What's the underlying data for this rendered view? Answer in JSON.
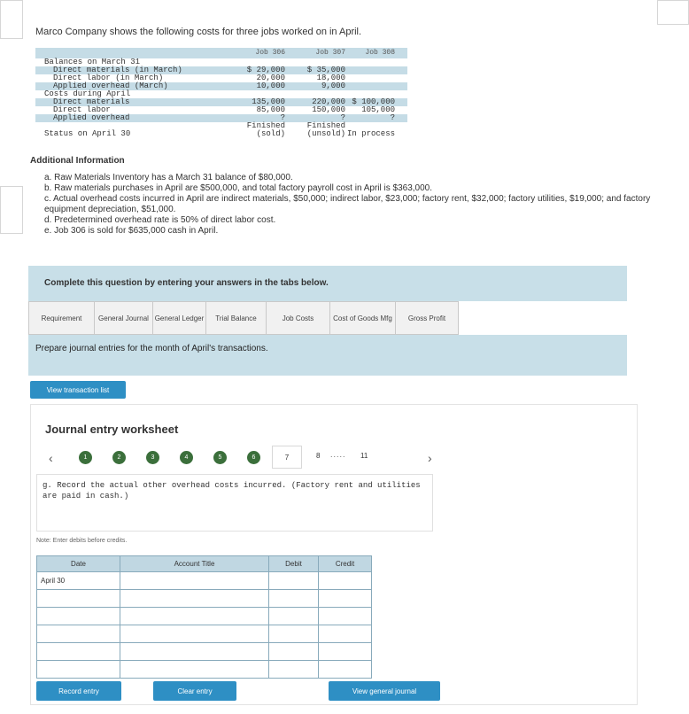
{
  "intro": "Marco Company shows the following costs for three jobs worked on in April.",
  "cost_table": {
    "jobs": [
      "Job 306",
      "Job 307",
      "Job 308"
    ],
    "rows": [
      {
        "label": "Balances on March 31",
        "indent": 0,
        "c1": "",
        "c2": "",
        "c3": "",
        "shade": false
      },
      {
        "label": "Direct materials (in March)",
        "indent": 1,
        "c1": "$ 29,000",
        "c2": "$ 35,000",
        "c3": "",
        "shade": true
      },
      {
        "label": "Direct labor (in March)",
        "indent": 1,
        "c1": "20,000",
        "c2": "18,000",
        "c3": "",
        "shade": false
      },
      {
        "label": "Applied overhead (March)",
        "indent": 1,
        "c1": "10,000",
        "c2": "9,000",
        "c3": "",
        "shade": true
      },
      {
        "label": "Costs during April",
        "indent": 0,
        "c1": "",
        "c2": "",
        "c3": "",
        "shade": false
      },
      {
        "label": "Direct materials",
        "indent": 1,
        "c1": "135,000",
        "c2": "220,000",
        "c3": "$ 100,000",
        "shade": true
      },
      {
        "label": "Direct labor",
        "indent": 1,
        "c1": "85,000",
        "c2": "150,000",
        "c3": "105,000",
        "shade": false
      },
      {
        "label": "Applied overhead",
        "indent": 1,
        "c1": "?",
        "c2": "?",
        "c3": "?",
        "shade": true
      },
      {
        "label": "",
        "indent": 0,
        "c1": "Finished",
        "c2": "Finished",
        "c3": "",
        "shade": false
      },
      {
        "label": "Status on April 30",
        "indent": 0,
        "c1": "(sold)",
        "c2": "(unsold)",
        "c3": "In process",
        "shade": false
      }
    ]
  },
  "additional": {
    "title": "Additional Information",
    "items": [
      "a. Raw Materials Inventory has a March 31 balance of $80,000.",
      "b. Raw materials purchases in April are $500,000, and total factory payroll cost in April is $363,000.",
      "c. Actual overhead costs incurred in April are indirect materials, $50,000; indirect labor, $23,000; factory rent, $32,000; factory utilities, $19,000; and factory equipment depreciation, $51,000.",
      "d. Predetermined overhead rate is 50% of direct labor cost.",
      "e. Job 306 is sold for $635,000 cash in April."
    ]
  },
  "instructions": "Complete this question by entering your answers in the tabs below.",
  "tabs": [
    {
      "label": "Requirement",
      "width": 74
    },
    {
      "label": "General Journal",
      "width": 66
    },
    {
      "label": "General Ledger",
      "width": 60
    },
    {
      "label": "Trial Balance",
      "width": 68
    },
    {
      "label": "Job Costs",
      "width": 72
    },
    {
      "label": "Cost of Goods Mfg",
      "width": 74
    },
    {
      "label": "Gross Profit",
      "width": 72
    }
  ],
  "prepare_text": "Prepare journal entries for the month of April's transactions.",
  "view_transaction_list": "View transaction list",
  "worksheet": {
    "title": "Journal entry worksheet",
    "pages": [
      "1",
      "2",
      "3",
      "4",
      "5",
      "6"
    ],
    "current_page": "7",
    "next_page": "8",
    "dots": ".....",
    "last_page": "11",
    "question": "g. Record the actual other overhead costs incurred. (Factory rent and utilities are paid in cash.)",
    "note": "Note: Enter debits before credits.",
    "columns": [
      "Date",
      "Account Title",
      "Debit",
      "Credit"
    ],
    "date_value": "April 30"
  },
  "buttons": {
    "record": "Record entry",
    "clear": "Clear entry",
    "view_journal": "View general journal"
  }
}
